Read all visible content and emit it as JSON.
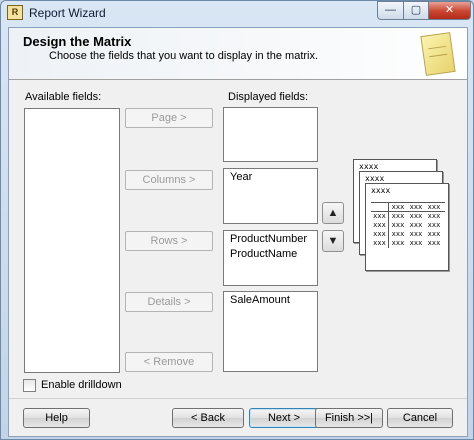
{
  "window": {
    "title": "Report Wizard",
    "app_icon": "report-wizard-icon",
    "controls": {
      "minimize": "—",
      "maximize": "▢",
      "close": "✕"
    }
  },
  "header": {
    "title": "Design the Matrix",
    "subtitle": "Choose the fields that you want to display in the matrix.",
    "icon": "report-page-icon"
  },
  "available": {
    "label": "Available fields:",
    "items": []
  },
  "displayed": {
    "label": "Displayed fields:",
    "page": {
      "button": "Page >",
      "items": []
    },
    "columns": {
      "button": "Columns >",
      "items": [
        "Year"
      ]
    },
    "rows": {
      "button": "Rows >",
      "items": [
        "ProductNumber",
        "ProductName"
      ]
    },
    "details": {
      "button": "Details >",
      "items": [
        "SaleAmount"
      ]
    }
  },
  "remove_button": "< Remove",
  "move_up_icon": "arrow-up-icon",
  "move_down_icon": "arrow-down-icon",
  "preview": {
    "page_label": "xxxx",
    "column_label": "xxxx",
    "row_label": "xxxx",
    "header_cells": [
      "",
      "xxx",
      "xxx",
      "xxx"
    ],
    "data_rows": [
      [
        "xxx",
        "xxx",
        "xxx",
        "xxx"
      ],
      [
        "xxx",
        "xxx",
        "xxx",
        "xxx"
      ],
      [
        "xxx",
        "xxx",
        "xxx",
        "xxx"
      ],
      [
        "xxx",
        "xxx",
        "xxx",
        "xxx"
      ]
    ]
  },
  "drilldown": {
    "label": "Enable drilldown",
    "checked": false
  },
  "footer": {
    "help": "Help",
    "back": "< Back",
    "next": "Next >",
    "finish": "Finish >>|",
    "cancel": "Cancel"
  }
}
